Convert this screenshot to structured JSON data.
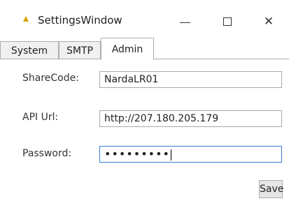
{
  "window": {
    "title": "SettingsWindow",
    "minimize_glyph": "—",
    "close_glyph": "✕"
  },
  "tabs": [
    {
      "label": "System",
      "active": false
    },
    {
      "label": "SMTP",
      "active": false
    },
    {
      "label": "Admin",
      "active": true
    }
  ],
  "form": {
    "sharecode_label": "ShareCode:",
    "sharecode_value": "NardaLR01",
    "apiurl_label": "API Url:",
    "apiurl_value": "http://207.180.205.179",
    "password_label": "Password:",
    "password_mask": "•••••••••"
  },
  "actions": {
    "save_label": "Save"
  },
  "colors": {
    "focus_border": "#3b7dd8",
    "tab_border": "#adadad",
    "button_bg": "#e5e5e5"
  }
}
